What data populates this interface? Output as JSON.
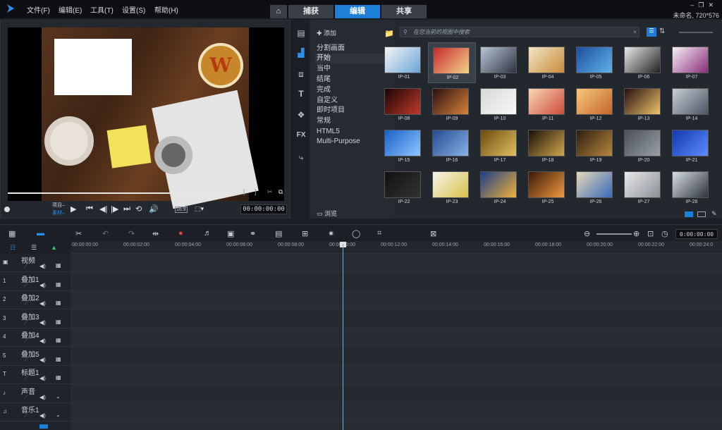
{
  "menu": [
    "文件(F)",
    "编辑(E)",
    "工具(T)",
    "设置(S)",
    "帮助(H)"
  ],
  "tabs": {
    "capture": "捕获",
    "edit": "编辑",
    "share": "共享"
  },
  "project_info": "未命名, 720*576",
  "preview": {
    "project_label": "项目–",
    "clip_label": "素材–",
    "timecode": "00:00:00:00",
    "aspect": "16:9"
  },
  "library": {
    "add_label": "添加",
    "browse_label": "浏览",
    "search_placeholder": "在您当前的视图中搜索",
    "categories": [
      "分割画面",
      "开始",
      "当中",
      "结尾",
      "完成",
      "自定义",
      "即时项目",
      "常规",
      "HTML5",
      "Multi-Purpose"
    ],
    "selected_category": "开始",
    "items": [
      "IP-01",
      "IP-02",
      "IP-03",
      "IP-04",
      "IP-05",
      "IP-06",
      "IP-07",
      "IP-08",
      "IP-09",
      "IP-10",
      "IP-11",
      "IP-12",
      "IP-13",
      "IP-14",
      "IP-15",
      "IP-16",
      "IP-17",
      "IP-18",
      "IP-19",
      "IP-20",
      "IP-21",
      "IP-22",
      "IP-23",
      "IP-24",
      "IP-25",
      "IP-26",
      "IP-27",
      "IP-28"
    ],
    "selected_item": "IP-02"
  },
  "timeline": {
    "timecode": "0:00:00:00",
    "ruler": [
      "00:00:00:00",
      "00:00:02:00",
      "00:00:04:00",
      "00:00:06:00",
      "00:00:08:00",
      "00:00:10:00",
      "00:00:12:00",
      "00:00:14:00",
      "00:00:16:00",
      "00:00:18:00",
      "00:00:20:00",
      "00:00:22:00",
      "00:00:24:0"
    ],
    "tracks": [
      "视频",
      "叠加1",
      "叠加2",
      "叠加3",
      "叠加4",
      "叠加5",
      "标题1",
      "声音",
      "音乐1"
    ]
  }
}
